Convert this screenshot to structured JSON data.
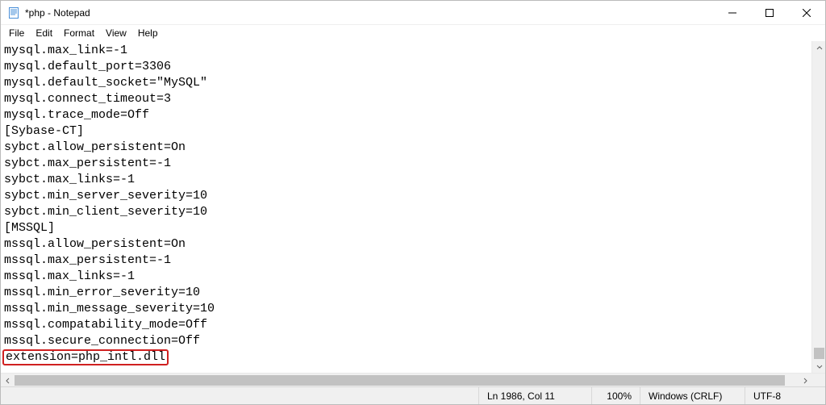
{
  "titlebar": {
    "title": "*php - Notepad"
  },
  "menubar": {
    "file": "File",
    "edit": "Edit",
    "format": "Format",
    "view": "View",
    "help": "Help"
  },
  "editor": {
    "lines": [
      "mysql.max_link=-1",
      "mysql.default_port=3306",
      "mysql.default_socket=\"MySQL\"",
      "mysql.connect_timeout=3",
      "mysql.trace_mode=Off",
      "[Sybase-CT]",
      "sybct.allow_persistent=On",
      "sybct.max_persistent=-1",
      "sybct.max_links=-1",
      "sybct.min_server_severity=10",
      "sybct.min_client_severity=10",
      "[MSSQL]",
      "mssql.allow_persistent=On",
      "mssql.max_persistent=-1",
      "mssql.max_links=-1",
      "mssql.min_error_severity=10",
      "mssql.min_message_severity=10",
      "mssql.compatability_mode=Off",
      "mssql.secure_connection=Off"
    ],
    "highlighted_line": "extension=php_intl.dll"
  },
  "statusbar": {
    "linecol": "Ln 1986, Col 11",
    "zoom": "100%",
    "eol": "Windows (CRLF)",
    "enc": "UTF-8"
  }
}
